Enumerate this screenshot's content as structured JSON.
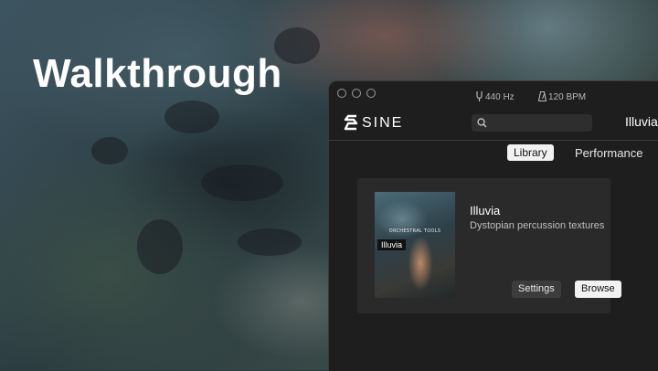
{
  "headline": "Walkthrough",
  "window": {
    "tuning": "440 Hz",
    "tempo": "120 BPM",
    "logo": "SINE",
    "search": {
      "value": "",
      "placeholder": ""
    },
    "instrument_name": "Illuvia",
    "tabs": [
      {
        "label": "Library",
        "active": true
      },
      {
        "label": "Performance",
        "active": false
      }
    ],
    "card": {
      "cover_label": "Illuvia",
      "cover_strip_text": "ORCHESTRAL TOOLS",
      "title": "Illuvia",
      "description": "Dystopian percussion textures",
      "settings_label": "Settings",
      "browse_label": "Browse"
    }
  },
  "colors": {
    "window_bg": "#1e1e1f",
    "card_bg": "#2a2a2b",
    "active_tab_bg": "#f2f2f2"
  }
}
